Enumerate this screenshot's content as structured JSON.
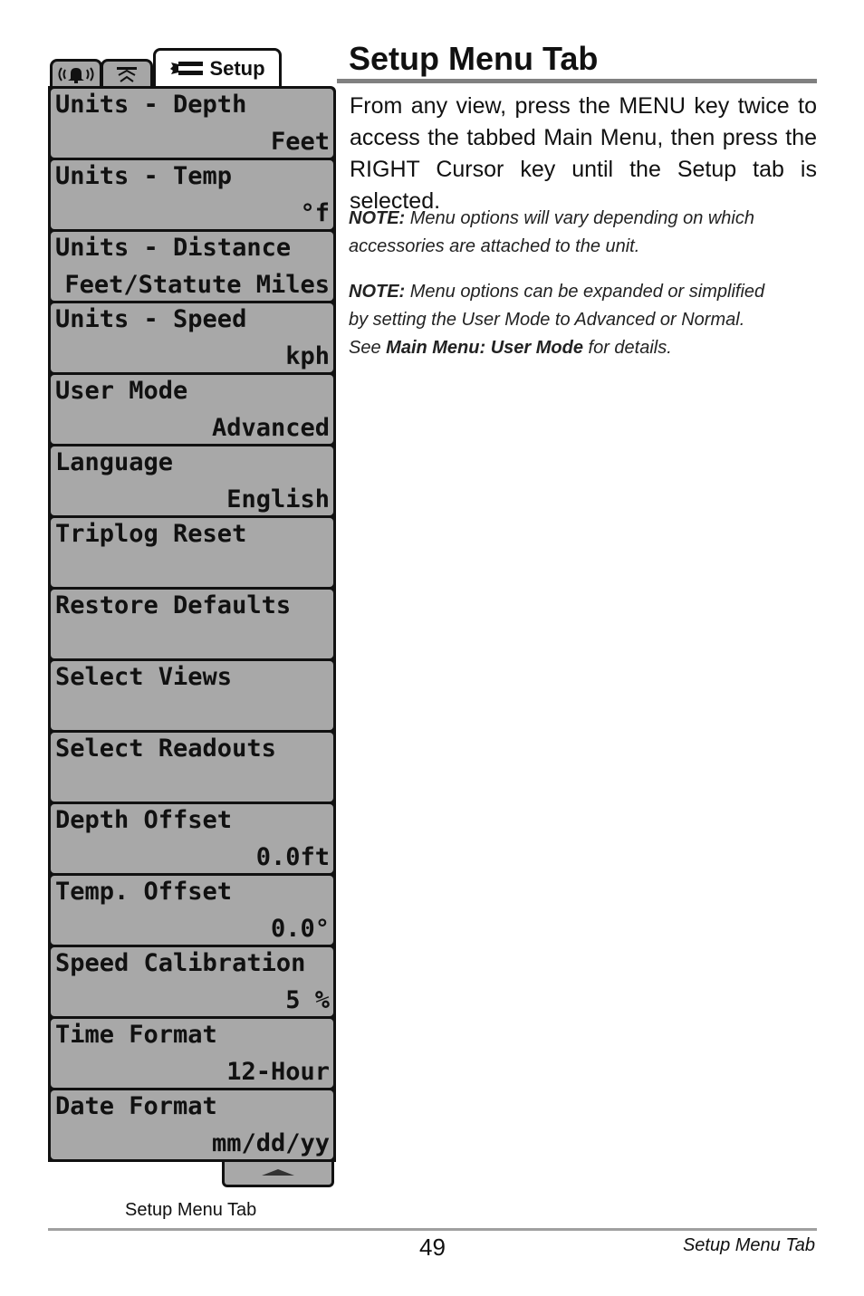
{
  "menu": {
    "tabs": [
      {
        "name": "alarms",
        "icon": "alarm-bell-icon",
        "label": ""
      },
      {
        "name": "sonar",
        "icon": "sonar-icon",
        "label": ""
      },
      {
        "name": "setup",
        "icon": "wrench-icon",
        "label": "Setup",
        "selected": true
      }
    ],
    "items": [
      {
        "label": "Units - Depth",
        "value": "Feet"
      },
      {
        "label": "Units - Temp",
        "value": "°f"
      },
      {
        "label": "Units - Distance",
        "value": "Feet/Statute Miles"
      },
      {
        "label": "Units - Speed",
        "value": "kph"
      },
      {
        "label": "User Mode",
        "value": "Advanced"
      },
      {
        "label": "Language",
        "value": "English"
      },
      {
        "label": "Triplog Reset",
        "value": ""
      },
      {
        "label": "Restore Defaults",
        "value": ""
      },
      {
        "label": "Select Views",
        "value": ""
      },
      {
        "label": "Select Readouts",
        "value": ""
      },
      {
        "label": "Depth Offset",
        "value": "0.0ft"
      },
      {
        "label": "Temp. Offset",
        "value": "0.0°"
      },
      {
        "label": "Speed Calibration",
        "value": "5 %"
      },
      {
        "label": "Time Format",
        "value": "12-Hour"
      },
      {
        "label": "Date Format",
        "value": "mm/dd/yy"
      }
    ],
    "scroll_icon": "scroll-up-icon",
    "caption": "Setup Menu Tab"
  },
  "content": {
    "heading": "Setup Menu Tab",
    "intro": "From any view, press the MENU key twice to access the tabbed Main Menu, then press the RIGHT Cursor key until the Setup tab is selected.",
    "note1": {
      "prefix": "NOTE:",
      "text": " Menu options will vary depending on which accessories are attached to the unit."
    },
    "note2": {
      "prefix": "NOTE:",
      "text": " Menu options can be expanded or simplified by setting the User Mode to Advanced or Normal. See ",
      "link": "Main Menu: User Mode",
      "suffix": " for details."
    }
  },
  "footer": {
    "page_number": "49",
    "section_title": "Setup Menu Tab"
  }
}
